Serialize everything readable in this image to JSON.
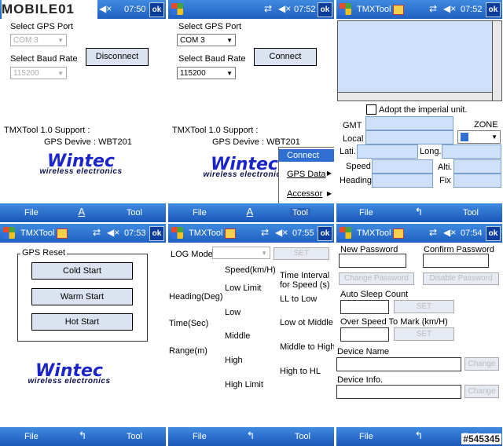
{
  "watermark": "MOBILE01",
  "watermark_id": "#545345",
  "app": {
    "title": "TMXTool",
    "ok": "ok"
  },
  "softkeys": {
    "left": "File",
    "right": "Tool",
    "input_icon": "keyboard-icon"
  },
  "screens": {
    "s1": {
      "time": "07:50",
      "gps_port_label": "Select GPS Port",
      "gps_port_value": "COM 3",
      "baud_label": "Select Baud Rate",
      "baud_value": "115200",
      "connect_btn": "Disconnect",
      "support_label": "TMXTool 1.0 Support :",
      "device_label": "GPS Devive : WBT201",
      "logo_main": "Wintec",
      "logo_sub": "wireless electronics"
    },
    "s2": {
      "time": "07:52",
      "gps_port_label": "Select GPS Port",
      "gps_port_value": "COM 3",
      "baud_label": "Select Baud Rate",
      "baud_value": "115200",
      "connect_btn": "Connect",
      "support_label": "TMXTool 1.0 Support :",
      "device_label": "GPS Devive : WBT201",
      "logo_main": "Wintec",
      "logo_sub": "wireless electronics",
      "menu": [
        "Connect",
        "GPS Data",
        "Accessor"
      ]
    },
    "s3": {
      "time": "07:52",
      "imperial": "Adopt the imperial unit.",
      "gmt": "GMT",
      "zone": "ZONE",
      "local": "Local",
      "lati": "Lati.",
      "long": "Long.",
      "speed": "Speed",
      "alti": "Alti.",
      "heading": "Heading",
      "fix": "Fix"
    },
    "s4": {
      "time": "07:53",
      "group_label": "GPS Reset",
      "cold": "Cold Start",
      "warm": "Warm Start",
      "hot": "Hot Start",
      "logo_main": "Wintec",
      "logo_sub": "wireless electronics"
    },
    "s5": {
      "time": "07:55",
      "log_mode": "LOG Mode",
      "set": "SET",
      "speed_kmh": "Speed(km/H)",
      "low_limit": "Low Limit",
      "heading_deg": "Heading(Deg)",
      "low": "Low",
      "time_sec": "Time(Sec)",
      "middle": "Middle",
      "range_m": "Range(m)",
      "high": "High",
      "high_limit": "High Limit",
      "time_interval": "Time Interval",
      "for_speed": "for Speed (s)",
      "ll_to_low": "LL to Low",
      "low_to_middle": "Low ot Middle",
      "middle_to_high": "Middle to High",
      "high_to_hl": "High to HL"
    },
    "s6": {
      "time": "07:54",
      "new_password": "New Password",
      "confirm_password": "Confirm Password",
      "change_password": "Change Password",
      "disable_password": "Disable Password",
      "auto_sleep": "Auto Sleep Count",
      "set": "SET",
      "over_speed": "Over Speed To Mark (km/H)",
      "device_name": "Device Name",
      "change": "Change",
      "device_info": "Device Info.",
      "change2": "Change"
    }
  }
}
